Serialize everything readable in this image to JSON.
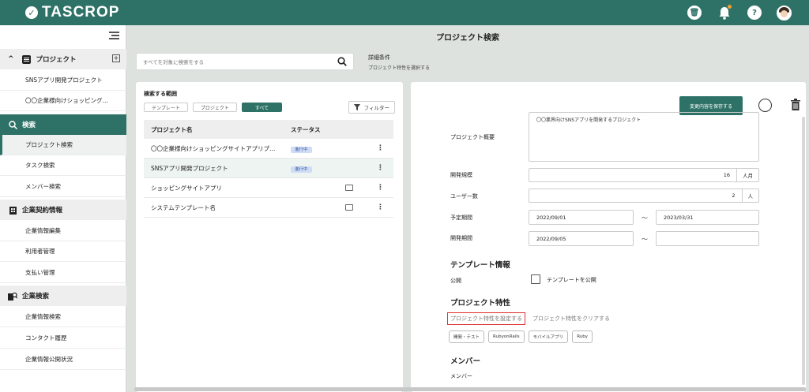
{
  "app": {
    "logo_text": "TASCROP"
  },
  "sidebar": {
    "project_section": "プロジェクト",
    "project_items": [
      "SNSアプリ開発プロジェクト",
      "〇〇企業様向けショッピング…"
    ],
    "search_section": "検索",
    "search_items": [
      "プロジェクト検索",
      "タスク検索",
      "メンバー検索"
    ],
    "contract_section": "企業契約情報",
    "contract_items": [
      "企業情報編集",
      "利用者管理",
      "支払い管理"
    ],
    "company_search_section": "企業検索",
    "company_search_items": [
      "企業情報検索",
      "コンタクト履歴",
      "企業情報公開状況"
    ]
  },
  "main": {
    "title": "プロジェクト検索",
    "search_placeholder": "すべてを対象に検索をする",
    "detail_title": "詳細条件",
    "detail_sub": "プロジェクト特性を選択する"
  },
  "left": {
    "scope_label": "検索する範囲",
    "scope_buttons": [
      "テンプレート",
      "プロジェクト",
      "すべて"
    ],
    "filter_label": "フィルター",
    "col_name": "プロジェクト名",
    "col_status": "ステータス",
    "rows": [
      {
        "name": "〇〇企業様向けショッピングサイトアプリプ…",
        "status": "進行中"
      },
      {
        "name": "SNSアプリ開発プロジェクト",
        "status": "進行中"
      },
      {
        "name": "ショッピングサイトアプリ",
        "status": ""
      },
      {
        "name": "システムテンプレート名",
        "status": ""
      }
    ]
  },
  "right": {
    "save_label": "変更内容を保存する",
    "overview_label": "プロジェクト概要",
    "overview_text": "〇〇業界向けSNSアプリを開発するプロジェクト",
    "scale_label": "開発規模",
    "scale_value": "16",
    "scale_unit": "人月",
    "users_label": "ユーザー数",
    "users_value": "2",
    "users_unit": "人",
    "planned_label": "予定期間",
    "planned_start": "2022/09/01",
    "planned_end": "2023/03/31",
    "dev_label": "開発期間",
    "dev_start": "2022/09/05",
    "tilde": "～",
    "template_section": "テンプレート情報",
    "public_label": "公開",
    "public_checkbox": "テンプレートを公開",
    "traits_section": "プロジェクト特性",
    "set_traits": "プロジェクト特性を設定する",
    "clear_traits": "プロジェクト特性をクリアする",
    "tags": [
      "開発・テスト",
      "RubyonRails",
      "モバイルアプリ",
      "Ruby"
    ],
    "member_section": "メンバー",
    "member_label": "メンバー"
  },
  "colors": {
    "brand": "#2e7267",
    "highlight_border": "#e03030",
    "badge": "#cfdcf5"
  }
}
